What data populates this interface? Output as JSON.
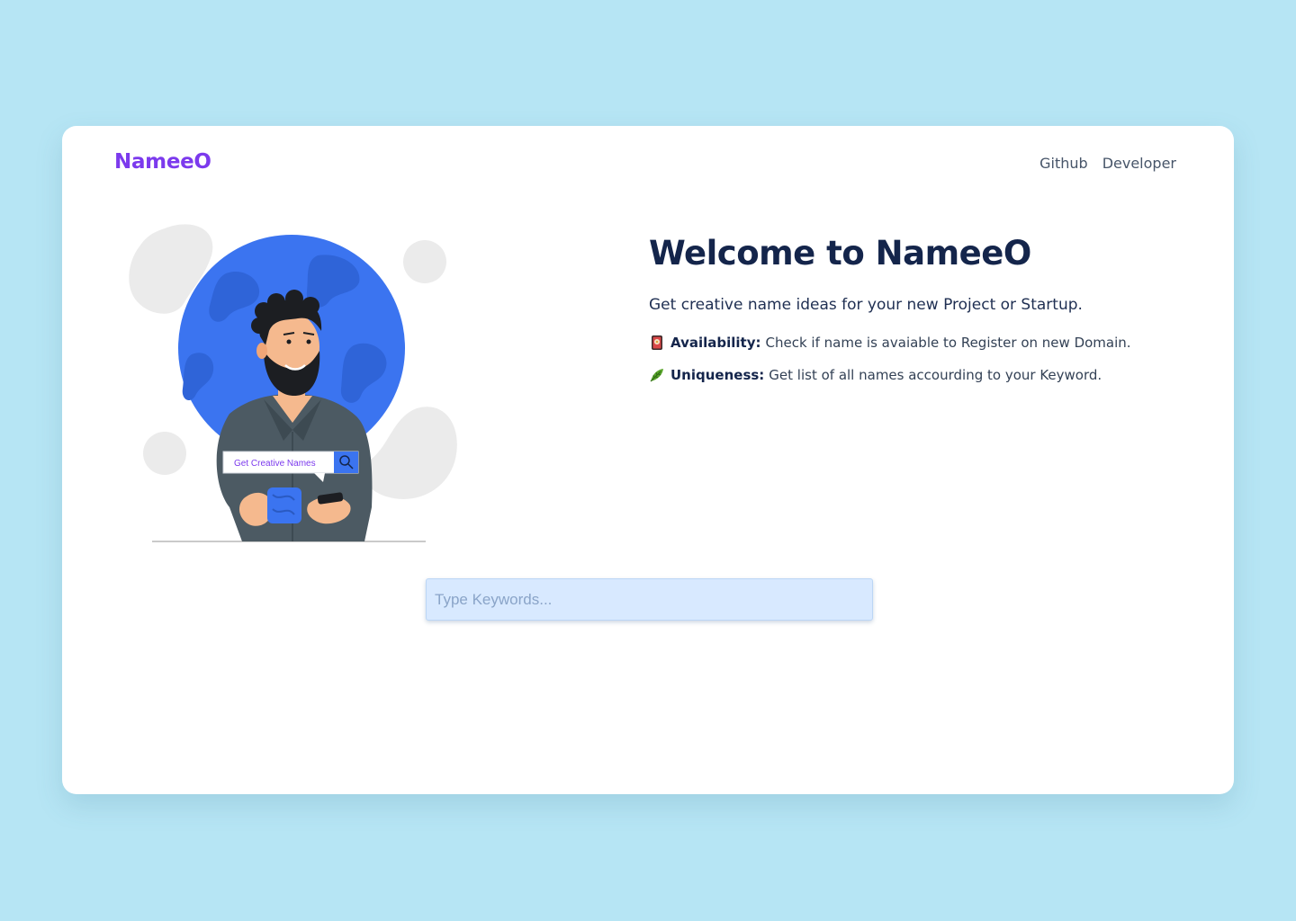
{
  "brand": {
    "name": "NameeO",
    "color": "#7c3aed"
  },
  "nav": {
    "items": [
      {
        "label": "Github"
      },
      {
        "label": "Developer"
      }
    ]
  },
  "illustration": {
    "search_bar_text": "Get Creative Names",
    "icon": "search-icon"
  },
  "hero": {
    "title": "Welcome to NameeO",
    "subtitle": "Get creative name ideas for your new Project or Startup.",
    "features": [
      {
        "icon": "flower-card-emoji-icon",
        "label": "Availability:",
        "text": "Check if name is avaiable to Register on new Domain."
      },
      {
        "icon": "leaf-emoji-icon",
        "label": "Uniqueness:",
        "text": "Get list of all names accourding to your Keyword."
      }
    ]
  },
  "search": {
    "placeholder": "Type Keywords..."
  },
  "colors": {
    "background": "#b6e5f4",
    "card": "#ffffff",
    "heading": "#14254b",
    "globe": "#3b74f0",
    "input_bg": "#d8e9ff"
  }
}
